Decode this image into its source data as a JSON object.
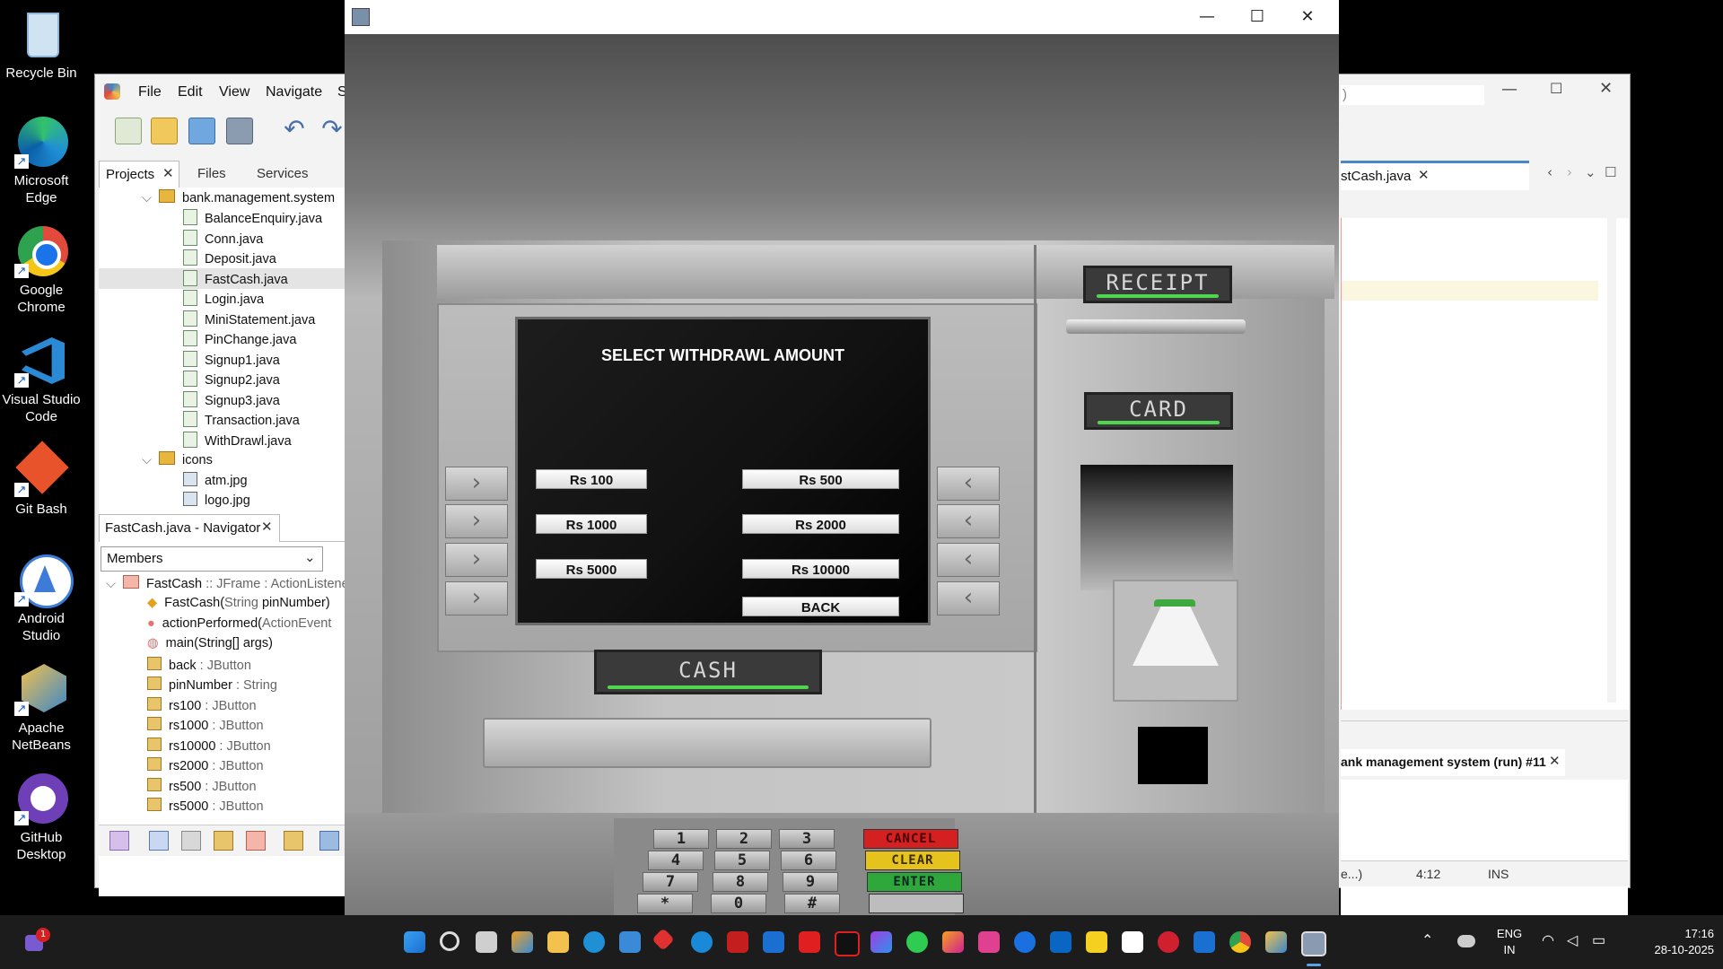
{
  "desktop": {
    "icons": [
      {
        "label": "Recycle Bin",
        "color": "#7fb7e6"
      },
      {
        "label": "Microsoft Edge",
        "color": "#1f8fd6"
      },
      {
        "label": "Google Chrome",
        "color": "#e24a3b"
      },
      {
        "label": "Visual Studio Code",
        "color": "#2a8ad6"
      },
      {
        "label": "Git Bash",
        "color": "#e8532c"
      },
      {
        "label": "Android Studio",
        "color": "#3d7bd8"
      },
      {
        "label": "Apache NetBeans",
        "color": "#3c87c8"
      },
      {
        "label": "GitHub Desktop",
        "color": "#6f3fb8"
      }
    ]
  },
  "netbeans": {
    "menu": [
      "File",
      "Edit",
      "View",
      "Navigate",
      "S"
    ],
    "panel_tabs": [
      "Projects",
      "Files",
      "Services"
    ],
    "tree": {
      "package": "bank.management.system",
      "files": [
        "BalanceEnquiry.java",
        "Conn.java",
        "Deposit.java",
        "FastCash.java",
        "Login.java",
        "MiniStatement.java",
        "PinChange.java",
        "Signup1.java",
        "Signup2.java",
        "Signup3.java",
        "Transaction.java",
        "WithDrawl.java"
      ],
      "selected": "FastCash.java",
      "icons_folder": "icons",
      "icon_files": [
        "atm.jpg",
        "logo.jpg"
      ]
    },
    "navigator": {
      "title": "FastCash.java - Navigator",
      "filter": "Members",
      "class_name": "FastCash",
      "class_sig": " :: JFrame : ActionListener",
      "members": [
        {
          "name": "FastCash(",
          "type": "String",
          "rest": " pinNumber)"
        },
        {
          "name": "actionPerformed(",
          "type": "ActionEvent",
          "rest": ""
        },
        {
          "name": "main(String[] args)",
          "type": "",
          "rest": ""
        },
        {
          "name": "back",
          "type": " : JButton",
          "rest": ""
        },
        {
          "name": "pinNumber",
          "type": " : String",
          "rest": ""
        },
        {
          "name": "rs100",
          "type": " : JButton",
          "rest": ""
        },
        {
          "name": "rs1000",
          "type": " : JButton",
          "rest": ""
        },
        {
          "name": "rs10000",
          "type": " : JButton",
          "rest": ""
        },
        {
          "name": "rs2000",
          "type": " : JButton",
          "rest": ""
        },
        {
          "name": "rs500",
          "type": " : JButton",
          "rest": ""
        },
        {
          "name": "rs5000",
          "type": " : JButton",
          "rest": ""
        }
      ]
    },
    "editor_tab": "stCash.java",
    "output_tab": "ank management system (run) #11",
    "status_left": "e...)",
    "status_pos": "4:12",
    "status_mode": "INS",
    "title_fragment": ")"
  },
  "atm": {
    "screen_title": "SELECT WITHDRAWL AMOUNT",
    "buttons": {
      "rs100": "Rs 100",
      "rs500": "Rs 500",
      "rs1000": "Rs 1000",
      "rs2000": "Rs 2000",
      "rs5000": "Rs 5000",
      "rs10000": "Rs 10000",
      "back": "BACK"
    },
    "labels": {
      "receipt": "RECEIPT",
      "card": "CARD",
      "cash": "CASH"
    },
    "keypad": [
      "1",
      "2",
      "3",
      "4",
      "5",
      "6",
      "7",
      "8",
      "9",
      "*",
      "0",
      "#"
    ],
    "function_keys": [
      {
        "label": "CANCEL",
        "color": "#d42020"
      },
      {
        "label": "CLEAR",
        "color": "#e6c21c"
      },
      {
        "label": "ENTER",
        "color": "#2ea83a"
      }
    ]
  },
  "taskbar": {
    "notification_badge": "1",
    "lang_line1": "ENG",
    "lang_line2": "IN",
    "time": "17:16",
    "date": "28-10-2025"
  }
}
